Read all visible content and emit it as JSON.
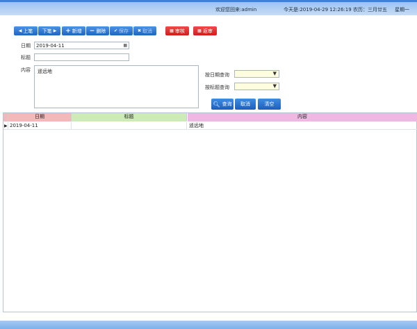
{
  "header": {
    "welcome": "欢迎您回来:admin",
    "today": "今天是:2019-04-29 12:26:19",
    "lunar": "农历：三月廿五",
    "weekday": "星期一"
  },
  "toolbar": {
    "prev": "上笔",
    "next": "下笔",
    "add": "新增",
    "delete": "删除",
    "save": "保存",
    "cancel": "取消",
    "audit": "审核",
    "unaudit": "返审"
  },
  "form": {
    "date_label": "日期",
    "date_value": "2019-04-11",
    "title_label": "标题",
    "title_value": "",
    "content_label": "内容",
    "content_value": "遥远地"
  },
  "search": {
    "by_date_label": "按日期查询",
    "by_title_label": "按标题查询",
    "query_button": "查询",
    "cancel_button": "取消",
    "clear_button": "清空"
  },
  "grid": {
    "columns": [
      "日期",
      "标题",
      "内容"
    ],
    "column_colors": [
      "#f4b8b8",
      "#cdebb6",
      "#efb8e2"
    ],
    "rows": [
      [
        "2019-04-11",
        "",
        "遥远地"
      ]
    ]
  }
}
